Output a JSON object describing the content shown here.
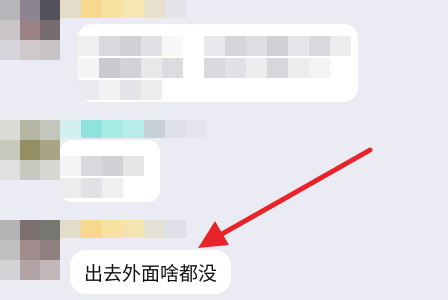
{
  "chat": {
    "last_message": "出去外面啥都没"
  },
  "colors": {
    "background": "#ebecf3",
    "bubble": "#ffffff",
    "arrow": "#e8242a"
  },
  "icons": {
    "annotation": "red-arrow-icon"
  }
}
